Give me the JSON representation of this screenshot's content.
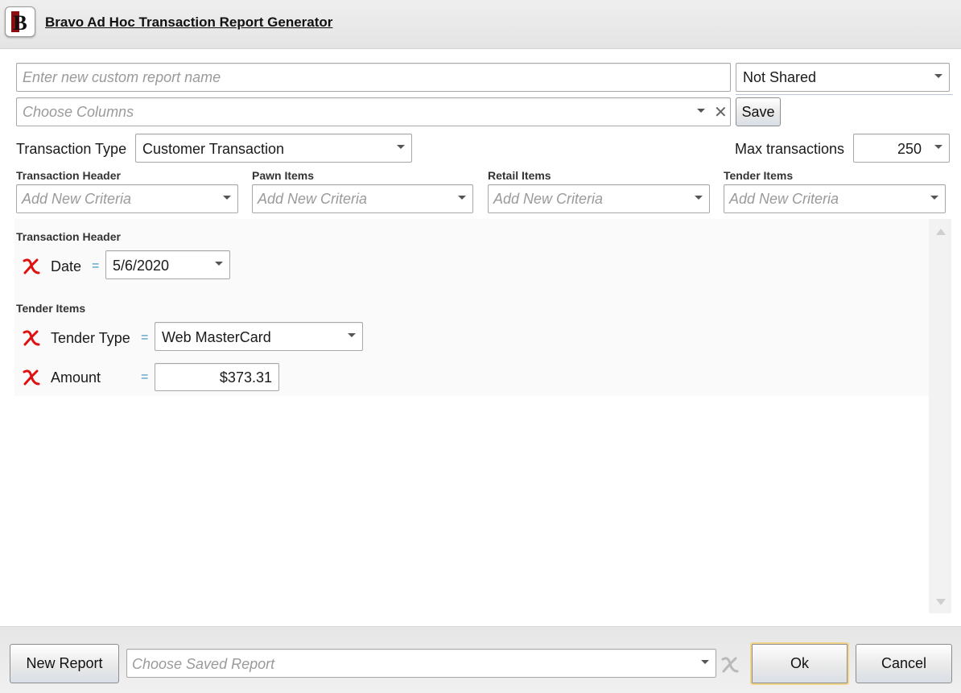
{
  "window": {
    "title": "Bravo Ad Hoc Transaction Report Generator",
    "logo_letter": "B"
  },
  "report": {
    "name_placeholder": "Enter new custom report name",
    "sharing_value": "Not Shared",
    "columns_placeholder": "Choose Columns",
    "save_label": "Save"
  },
  "transaction": {
    "type_label": "Transaction Type",
    "type_value": "Customer Transaction",
    "max_label": "Max transactions",
    "max_value": "250"
  },
  "criteria_groups": [
    {
      "label": "Transaction Header",
      "placeholder": "Add New Criteria"
    },
    {
      "label": "Pawn Items",
      "placeholder": "Add New Criteria"
    },
    {
      "label": "Retail Items",
      "placeholder": "Add New Criteria"
    },
    {
      "label": "Tender Items",
      "placeholder": "Add New Criteria"
    }
  ],
  "active_criteria": {
    "header_section": "Transaction Header",
    "date_label": "Date",
    "date_op": "=",
    "date_value": "5/6/2020",
    "tender_section": "Tender Items",
    "tender_type_label": "Tender Type",
    "tender_type_op": "=",
    "tender_type_value": "Web MasterCard",
    "amount_label": "Amount",
    "amount_op": "=",
    "amount_value": "$373.31"
  },
  "footer": {
    "new_report_label": "New Report",
    "saved_report_placeholder": "Choose Saved Report",
    "ok_label": "Ok",
    "cancel_label": "Cancel"
  },
  "colors": {
    "remove_icon": "#e01010",
    "accent_equal": "#3a8fb8",
    "ok_focus": "#f0d58a"
  },
  "icons": [
    "logo-icon",
    "dropdown-caret-icon",
    "clear-icon",
    "remove-criteria-icon",
    "scroll-up-icon",
    "scroll-down-icon"
  ]
}
